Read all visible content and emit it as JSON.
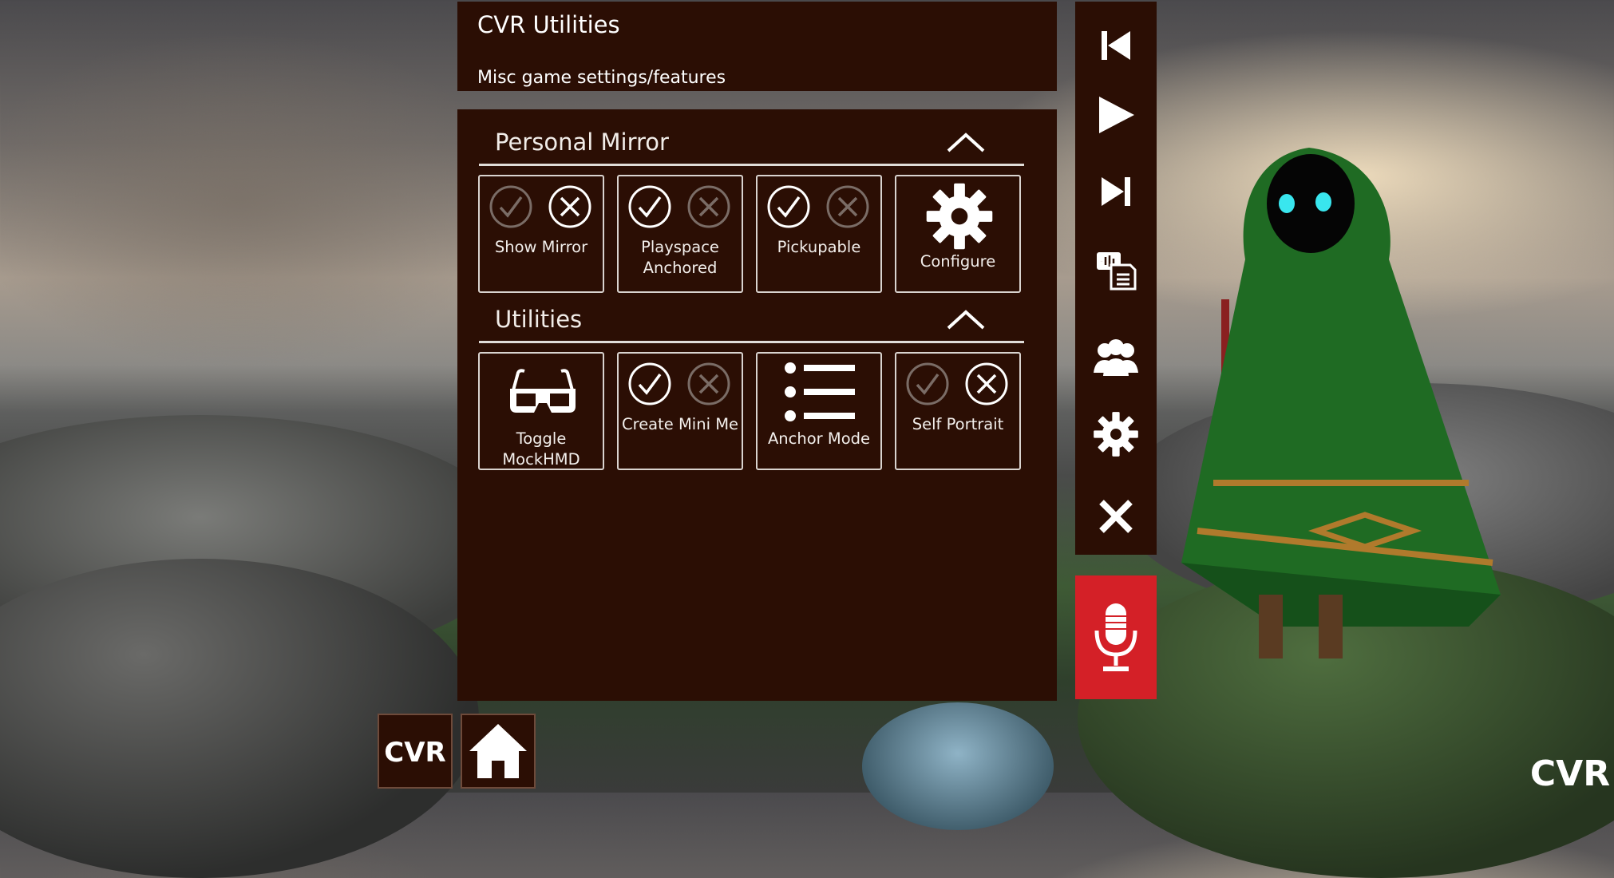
{
  "header": {
    "title": "CVR Utilities",
    "subtitle": "Misc game settings/features"
  },
  "sections": {
    "mirror": {
      "title": "Personal Mirror",
      "tiles": {
        "show_mirror": "Show Mirror",
        "playspace_anchored": "Playspace Anchored",
        "pickupable": "Pickupable",
        "configure": "Configure"
      }
    },
    "utilities": {
      "title": "Utilities",
      "tiles": {
        "toggle_mockhmd": "Toggle MockHMD",
        "create_mini_me": "Create Mini Me",
        "anchor_mode": "Anchor Mode",
        "self_portrait": "Self Portrait"
      }
    }
  },
  "states": {
    "show_mirror": "off",
    "playspace_anchored": "on",
    "pickupable": "on",
    "create_mini_me": "on",
    "self_portrait": "off"
  },
  "sidebar": {
    "icons": [
      "skip-back-icon",
      "play-icon",
      "skip-forward-icon",
      "chat-log-icon",
      "friends-icon",
      "settings-icon",
      "close-icon"
    ]
  },
  "bottom": {
    "logo": "CVR",
    "corner_logo": "CVR"
  },
  "colors": {
    "panel": "#2b0e04",
    "mic_active": "#d42027",
    "text": "#ffffff"
  }
}
